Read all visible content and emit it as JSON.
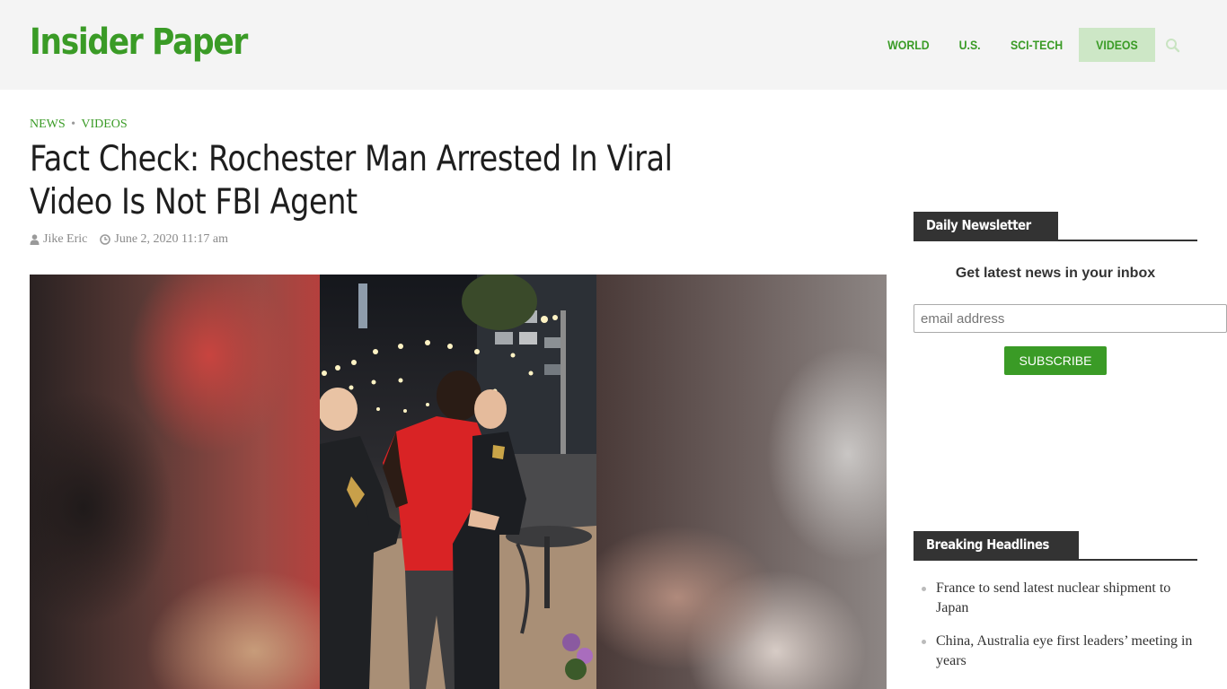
{
  "site": {
    "logo": "Insider Paper",
    "accent_color": "#3a9b26"
  },
  "nav": {
    "items": [
      {
        "label": "WORLD",
        "active": false
      },
      {
        "label": "U.S.",
        "active": false
      },
      {
        "label": "SCI-TECH",
        "active": false
      },
      {
        "label": "VIDEOS",
        "active": true
      }
    ],
    "search_icon": "search-icon"
  },
  "article": {
    "categories": [
      "NEWS",
      "VIDEOS"
    ],
    "category_separator": "•",
    "title": "Fact Check: Rochester Man Arrested In Viral Video Is Not FBI Agent",
    "author": "Jike Eric",
    "date": "June 2, 2020 11:17 am",
    "author_icon": "user-icon",
    "date_icon": "clock-icon"
  },
  "sidebar": {
    "newsletter": {
      "heading": "Daily Newsletter",
      "tagline": "Get latest news in your inbox",
      "email_placeholder": "email address",
      "button_label": "SUBSCRIBE"
    },
    "breaking": {
      "heading": "Breaking Headlines",
      "items": [
        "France to send latest nuclear shipment to Japan",
        "China, Australia eye first leaders’ meeting in years"
      ]
    }
  }
}
